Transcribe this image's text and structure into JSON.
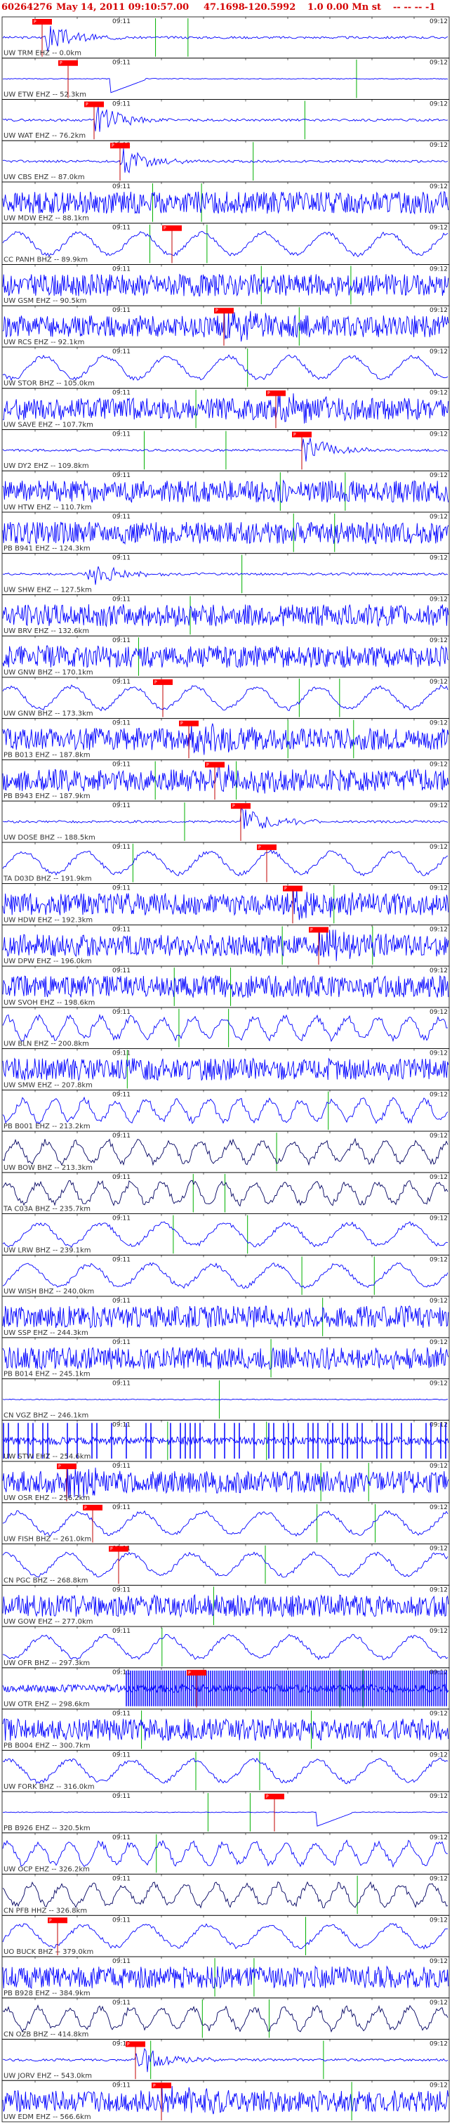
{
  "header": {
    "event_id": "60264276",
    "datetime": "May 14, 2011 09:10:57.00",
    "lat": "47.1698",
    "lon": "-120.5992",
    "depth_mag": "1.0 0.00 Mn st",
    "tail": "-- -- -- -1"
  },
  "tick_labels": {
    "left": "09:11",
    "right": "09:12"
  },
  "colors": {
    "trace": "#0000ff",
    "trace_dark": "#000060",
    "pick": "#ff0000",
    "pick_line": "#c00000",
    "marker": "#00b000",
    "header": "#d40000",
    "frame": "#000000"
  },
  "traces": [
    {
      "label": "UW TRM EHZ -- 0.0km",
      "style": "quiet-burst",
      "pick": "P"
    },
    {
      "label": "UW ETW EHZ -- 52.3km",
      "style": "flat-step",
      "pick": "P"
    },
    {
      "label": "UW WAT EHZ -- 76.2km",
      "style": "quiet-burst",
      "pick": "P"
    },
    {
      "label": "UW CBS EHZ -- 87.0km",
      "style": "quiet-burst",
      "pick": "P"
    },
    {
      "label": "UW MDW EHZ -- 88.1km",
      "style": "noisy",
      "pick": ""
    },
    {
      "label": "CC PANH BHZ -- 89.9km",
      "style": "slow-wave",
      "pick": "P"
    },
    {
      "label": "UW GSM EHZ -- 90.5km",
      "style": "noisy",
      "pick": ""
    },
    {
      "label": "UW RCS EHZ -- 92.1km",
      "style": "noisy-burst",
      "pick": "P"
    },
    {
      "label": "UW STOR BHZ -- 105.0km",
      "style": "slow-wave",
      "pick": ""
    },
    {
      "label": "UW SAVE EHZ -- 107.7km",
      "style": "noisy-burst",
      "pick": "P"
    },
    {
      "label": "UW DY2 EHZ -- 109.8km",
      "style": "quiet-burst",
      "pick": "P"
    },
    {
      "label": "UW HTW EHZ -- 110.7km",
      "style": "noisy",
      "pick": ""
    },
    {
      "label": "PB B941 EHZ -- 124.3km",
      "style": "noisy",
      "pick": ""
    },
    {
      "label": "UW SHW EHZ -- 127.5km",
      "style": "quiet-burst",
      "pick": ""
    },
    {
      "label": "UW BRV EHZ -- 132.6km",
      "style": "noisy",
      "pick": ""
    },
    {
      "label": "UW GNW BHZ -- 170.1km",
      "style": "noisy",
      "pick": ""
    },
    {
      "label": "UW GNW BHZ -- 173.3km",
      "style": "slow-wave",
      "pick": "P"
    },
    {
      "label": "PB B013 EHZ -- 187.8km",
      "style": "noisy-burst",
      "pick": "P"
    },
    {
      "label": "PB B943 EHZ -- 187.9km",
      "style": "noisy-burst",
      "pick": "P"
    },
    {
      "label": "UW DOSE BHZ -- 188.5km",
      "style": "flat-burst",
      "pick": "P"
    },
    {
      "label": "TA D03D BHZ -- 191.9km",
      "style": "slow-wave",
      "pick": "P"
    },
    {
      "label": "UW HDW EHZ -- 192.3km",
      "style": "noisy-burst",
      "pick": "P"
    },
    {
      "label": "UW DPW EHZ -- 196.0km",
      "style": "noisy-burst",
      "pick": "P"
    },
    {
      "label": "UW SVOH EHZ -- 198.6km",
      "style": "noisy",
      "pick": ""
    },
    {
      "label": "UW BLN EHZ -- 200.8km",
      "style": "mid-wave",
      "pick": ""
    },
    {
      "label": "UW SMW EHZ -- 207.8km",
      "style": "noisy",
      "pick": ""
    },
    {
      "label": "PB B001 EHZ -- 213.2km",
      "style": "mid-wave",
      "pick": ""
    },
    {
      "label": "UW BOW BHZ -- 213.3km",
      "style": "mid-wave-dark",
      "pick": ""
    },
    {
      "label": "TA C03A BHZ -- 235.7km",
      "style": "mid-wave-dark",
      "pick": ""
    },
    {
      "label": "UW LRW BHZ -- 239.1km",
      "style": "slow-wave",
      "pick": ""
    },
    {
      "label": "UW WISH BHZ -- 240.0km",
      "style": "slow-wave",
      "pick": ""
    },
    {
      "label": "UW SSP EHZ -- 244.3km",
      "style": "noisy",
      "pick": ""
    },
    {
      "label": "PB B014 EHZ -- 245.1km",
      "style": "noisy",
      "pick": ""
    },
    {
      "label": "CN VGZ BHZ -- 246.1km",
      "style": "flat",
      "pick": ""
    },
    {
      "label": "UW STW EHZ -- 254.6km",
      "style": "spiky",
      "pick": ""
    },
    {
      "label": "UW OSR EHZ -- 256.2km",
      "style": "noisy-burst",
      "pick": "P"
    },
    {
      "label": "UW FISH BHZ -- 261.0km",
      "style": "slow-wave",
      "pick": "P"
    },
    {
      "label": "CN PGC BHZ -- 268.8km",
      "style": "slow-wave",
      "pick": "P"
    },
    {
      "label": "UW GOW EHZ -- 277.0km",
      "style": "noisy",
      "pick": ""
    },
    {
      "label": "UW OFR BHZ -- 297.3km",
      "style": "slow-wave",
      "pick": ""
    },
    {
      "label": "UW OTR EHZ -- 298.6km",
      "style": "spiky-dense",
      "pick": "P"
    },
    {
      "label": "PB B004 EHZ -- 300.7km",
      "style": "noisy",
      "pick": ""
    },
    {
      "label": "UW FORK BHZ -- 316.0km",
      "style": "slow-wave",
      "pick": ""
    },
    {
      "label": "PB B926 EHZ -- 320.5km",
      "style": "flat-step",
      "pick": "P"
    },
    {
      "label": "UW OCP EHZ -- 326.2km",
      "style": "mid-wave",
      "pick": ""
    },
    {
      "label": "CN PFB HHZ -- 326.8km",
      "style": "mid-wave-dark",
      "pick": ""
    },
    {
      "label": "UO BUCK BHZ -- 379.0km",
      "style": "slow-wave",
      "pick": "P"
    },
    {
      "label": "PB B928 EHZ -- 384.9km",
      "style": "noisy",
      "pick": ""
    },
    {
      "label": "CN OZB BHZ -- 414.8km",
      "style": "mid-wave-dark",
      "pick": ""
    },
    {
      "label": "UW JORV EHZ -- 543.0km",
      "style": "quiet-burst",
      "pick": "P"
    },
    {
      "label": "UW EDM EHZ -- 566.6km",
      "style": "noisy-burst",
      "pick": "P"
    }
  ]
}
